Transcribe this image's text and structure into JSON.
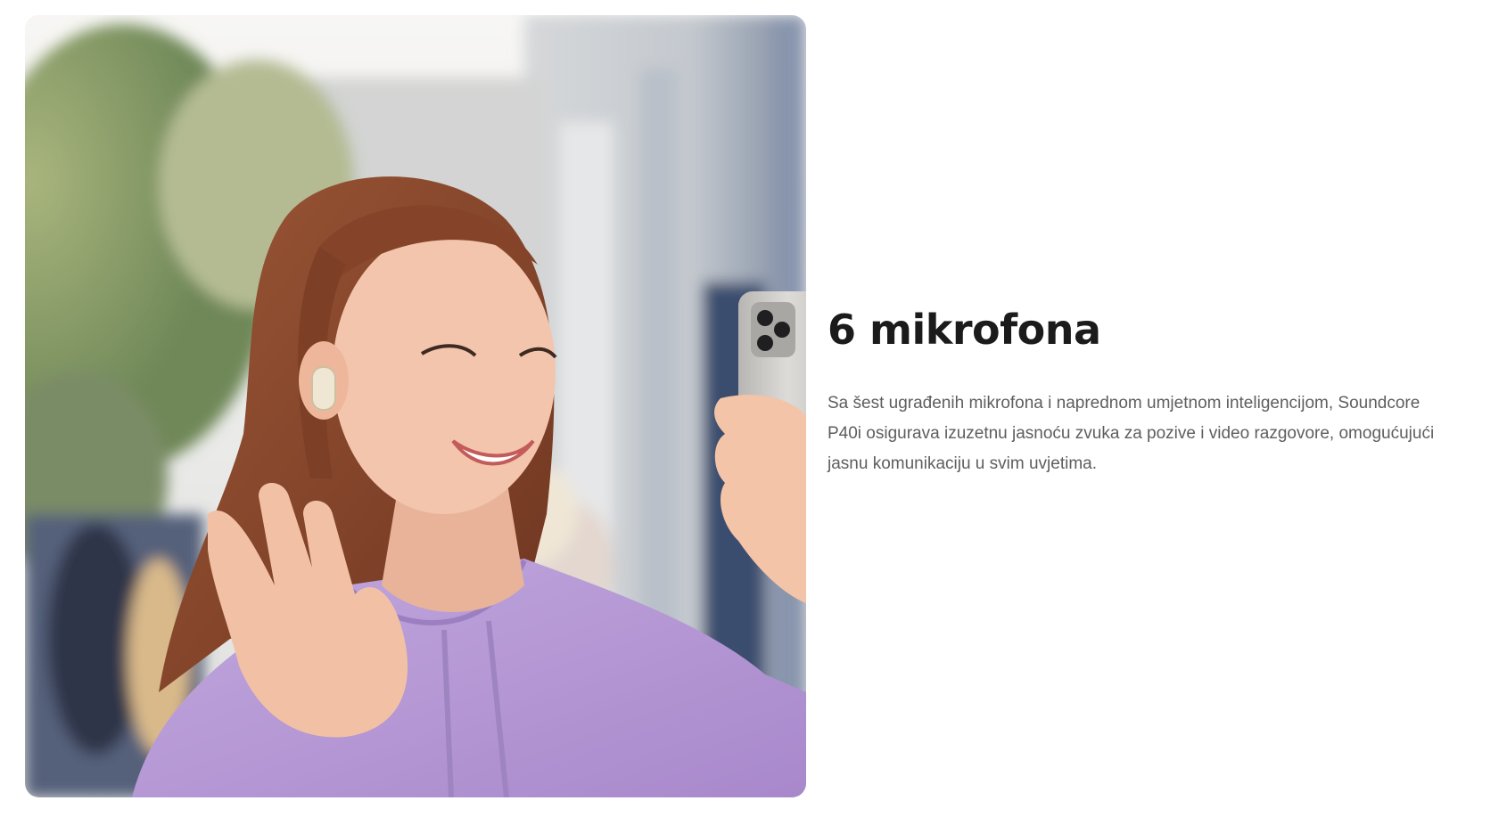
{
  "feature": {
    "title": "6 mikrofona",
    "description": "Sa šest ugrađenih mikrofona i naprednom umjetnom inteligencijom, Soundcore P40i osigurava izuzetnu jasnoću zvuka za pozive i video razgovore, omogućujući jasnu komunikaciju u svim uvjetima."
  },
  "image": {
    "subject": "woman-video-call-earbuds-photo",
    "colors": {
      "hoodie": "#b79bd6",
      "hair": "#8a4a2c",
      "skin": "#f1c2a8",
      "phone": "#c9c7c4",
      "background_trees": "#8ea06a",
      "background_building": "#c8ccd2"
    }
  },
  "colors": {
    "headline": "#1b1b1b",
    "body": "#5e5e5e",
    "background": "#ffffff"
  }
}
